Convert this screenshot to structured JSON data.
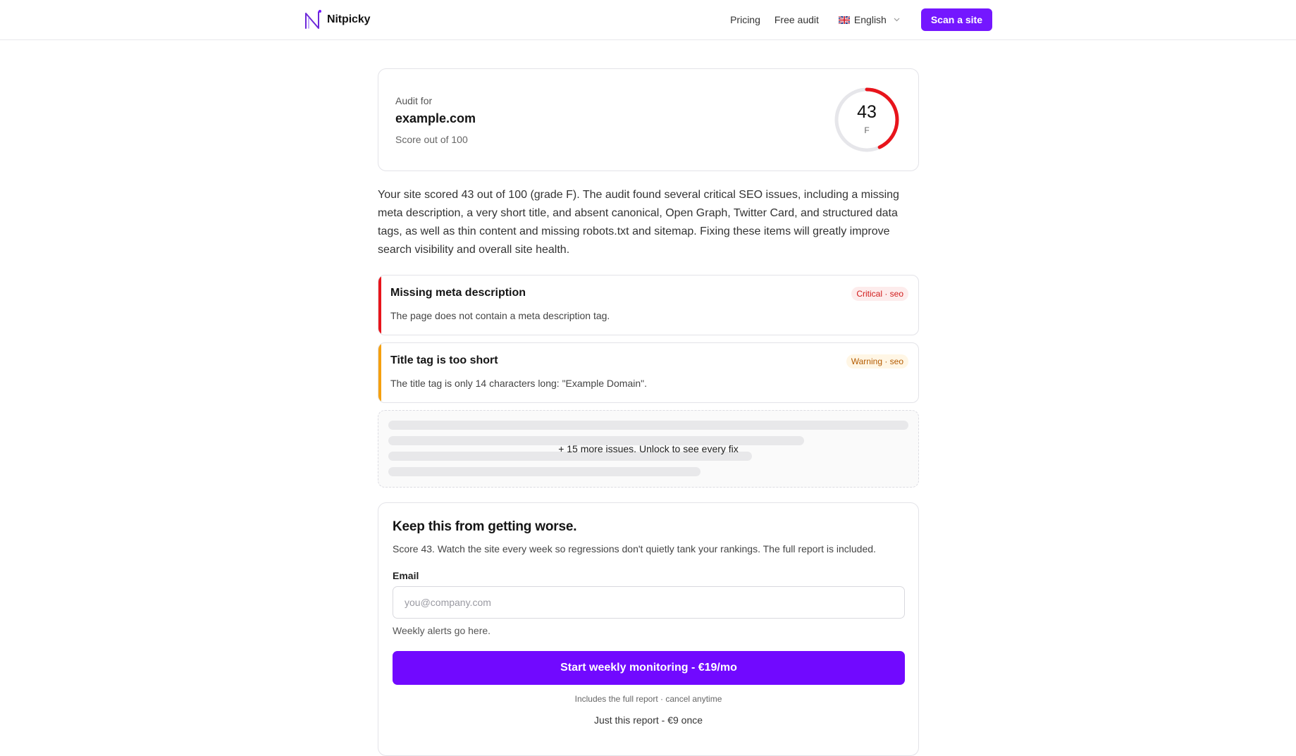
{
  "header": {
    "brand_name": "Nitpicky",
    "nav": [
      "Pricing",
      "Free audit"
    ],
    "language": "English",
    "cta": "Scan a site"
  },
  "score_card": {
    "audit_for_label": "Audit for",
    "domain": "example.com",
    "score_label": "Score out of 100",
    "score": 43,
    "score_text": "43",
    "grade": "F",
    "gauge_color": "#e8141b"
  },
  "summary": "Your site scored 43 out of 100 (grade F). The audit found several critical SEO issues, including a missing meta description, a very short title, and absent canonical, Open Graph, Twitter Card, and structured data tags, as well as thin content and missing robots.txt and sitemap. Fixing these items will greatly improve search visibility and overall site health.",
  "issues": [
    {
      "title": "Missing meta description",
      "description": "The page does not contain a meta description tag.",
      "badge": "Critical · seo",
      "severity": "critical",
      "color": "#e8141b"
    },
    {
      "title": "Title tag is too short",
      "description": "The title tag is only 14 characters long: \"Example Domain\".",
      "badge": "Warning · seo",
      "severity": "warning",
      "color": "#f5a00f"
    }
  ],
  "locked": {
    "text": "+ 15 more issues. Unlock to see every fix"
  },
  "monitor": {
    "title": "Keep this from getting worse.",
    "description": "Score 43. Watch the site every week so regressions don't quietly tank your rankings. The full report is included.",
    "email_label": "Email",
    "email_placeholder": "you@company.com",
    "email_value": "",
    "email_help": "Weekly alerts go here.",
    "button": "Start weekly monitoring - €19/mo",
    "button_note": "Includes the full report · cancel anytime",
    "once_link": "Just this report - €9 once"
  },
  "colors": {
    "accent": "#7417ff",
    "critical": "#e8141b",
    "warning": "#f5a00f"
  }
}
